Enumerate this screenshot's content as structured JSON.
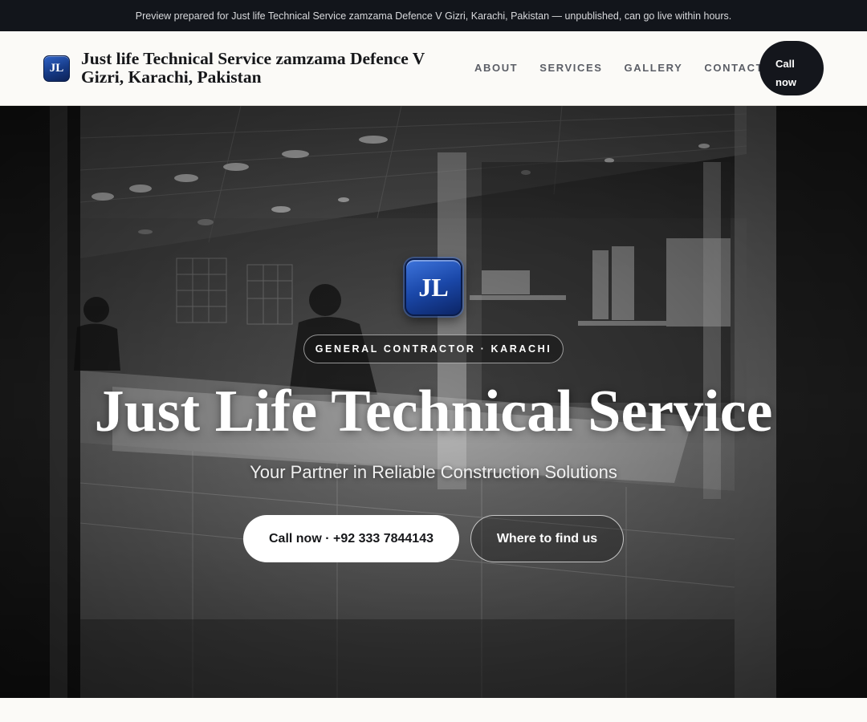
{
  "topbar": {
    "notice": "Preview prepared for Just life Technical Service zamzama Defence V Gizri, Karachi, Pakistan — unpublished, can go live within hours."
  },
  "header": {
    "logo_text": "JL",
    "brand_name": "Just life Technical Service zamzama Defence V Gizri, Karachi, Pakistan",
    "nav": [
      {
        "label": "ABOUT"
      },
      {
        "label": "SERVICES"
      },
      {
        "label": "GALLERY"
      },
      {
        "label": "CONTACT"
      }
    ],
    "call_label_line1": "Call",
    "call_label_line2": "now"
  },
  "hero": {
    "logo_text": "JL",
    "badge": "GENERAL CONTRACTOR · KARACHI",
    "title": "Just Life Technical Service",
    "subtitle": "Your Partner in Reliable Construction Solutions",
    "primary_button": "Call now · +92 333 7844143",
    "secondary_button": "Where to find us"
  },
  "colors": {
    "topbar_bg": "#12151b",
    "brand_blue": "#1a47a8",
    "dark_button": "#14161c",
    "page_bg": "#fbfaf7"
  }
}
